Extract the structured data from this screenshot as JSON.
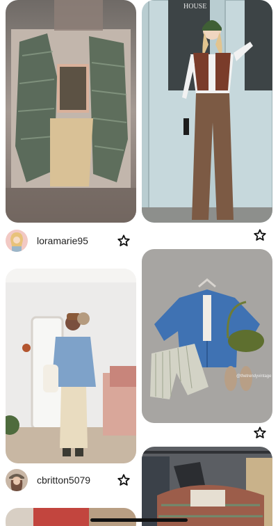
{
  "feed": {
    "posts": [
      {
        "username": "loramarie95",
        "avatar": "avatar-blonde-illustration",
        "action": "star-icon"
      },
      {
        "username": "",
        "action": "star-icon"
      },
      {
        "username": "cbritton5079",
        "avatar": "avatar-woman-hat",
        "action": "star-icon"
      },
      {
        "username": "",
        "action": "star-icon"
      },
      {
        "username": ""
      },
      {
        "username": ""
      }
    ],
    "image_subjects": [
      "green-plaid-shirt-outfit",
      "brown-corduroy-outfit",
      "denim-jacket-outfit",
      "denim-shirt-flatlay",
      "clothing-rack",
      "red-jacket-partial"
    ],
    "watermark": "@thetrendyvintage"
  },
  "colors": {
    "background": "#ffffff",
    "text": "#222222",
    "star_stroke": "#111111"
  }
}
